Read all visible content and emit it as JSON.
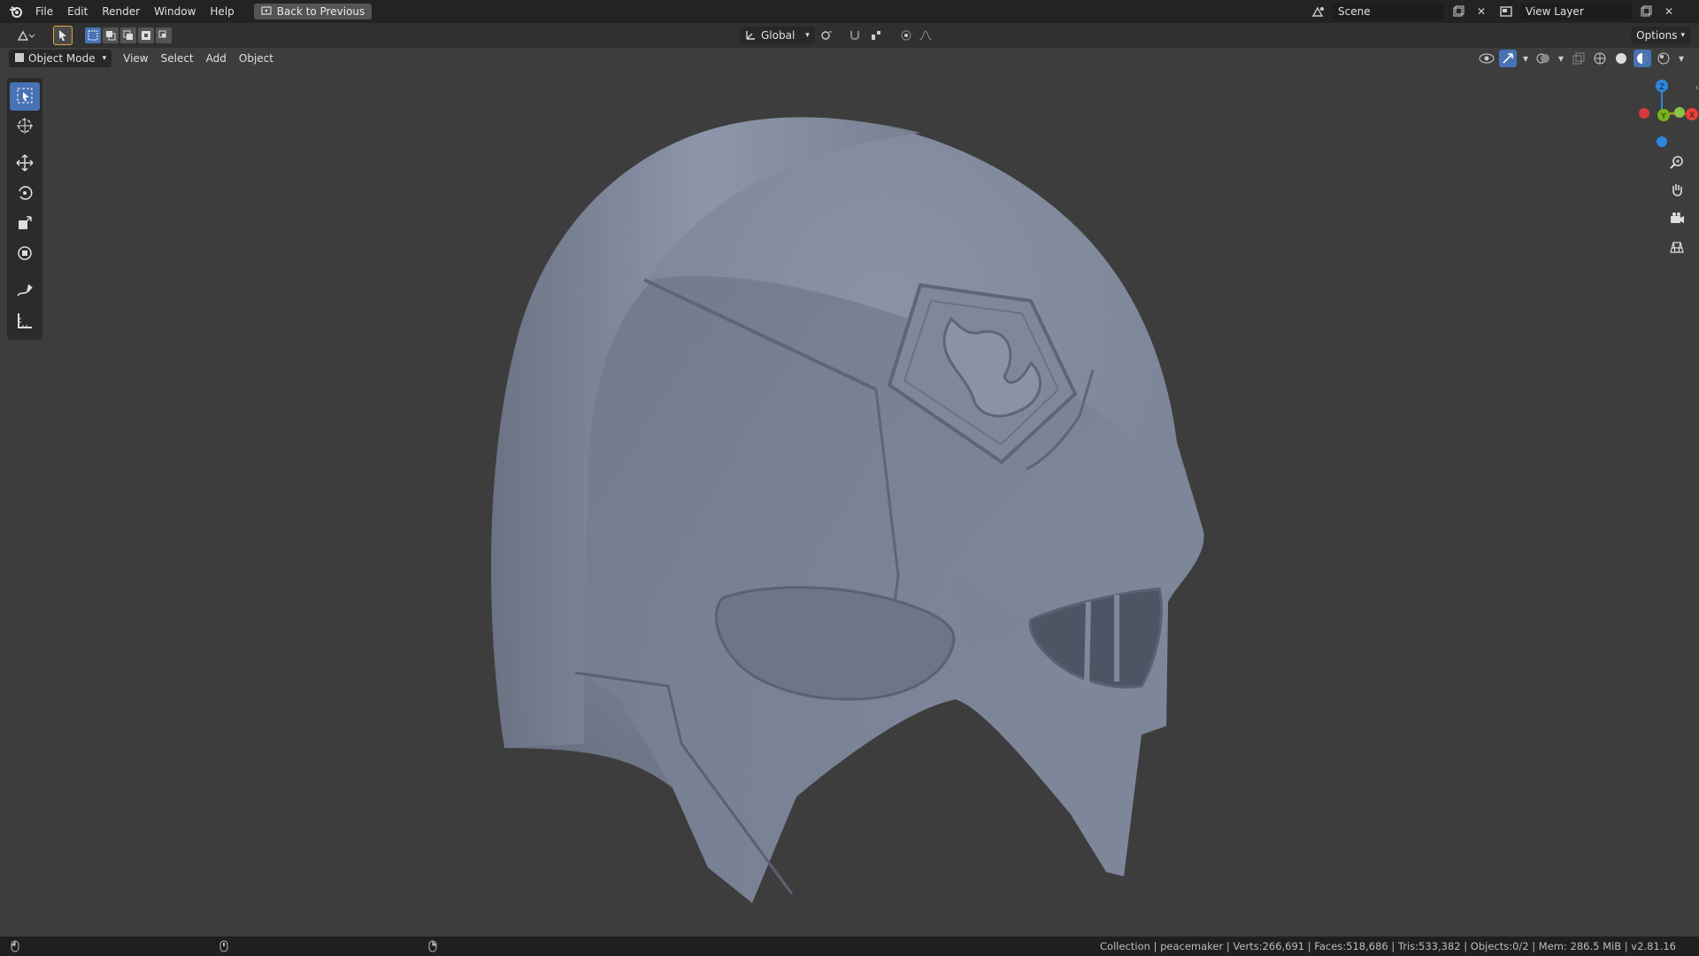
{
  "menu": {
    "items": [
      "File",
      "Edit",
      "Render",
      "Window",
      "Help"
    ],
    "back_button": "Back to Previous"
  },
  "scene": {
    "name": "Scene"
  },
  "view_layer": {
    "name": "View Layer"
  },
  "toolbar": {
    "transform_orientation": "Global",
    "options_label": "Options"
  },
  "header": {
    "mode": "Object Mode",
    "menus": [
      "View",
      "Select",
      "Add",
      "Object"
    ]
  },
  "gizmo": {
    "axes": {
      "x": "X",
      "y": "Y",
      "z": "Z"
    },
    "colors": {
      "x": "#e8413b",
      "y": "#7ab21b",
      "z": "#2e86de"
    }
  },
  "status": {
    "text": "Collection | peacemaker | Verts:266,691 | Faces:518,686 | Tris:533,382 | Objects:0/2 | Mem: 286.5 MiB | v2.81.16"
  },
  "colors": {
    "accent": "#4772b3",
    "viewport_bg": "#3d3d3d",
    "mesh": "#8790a2"
  }
}
